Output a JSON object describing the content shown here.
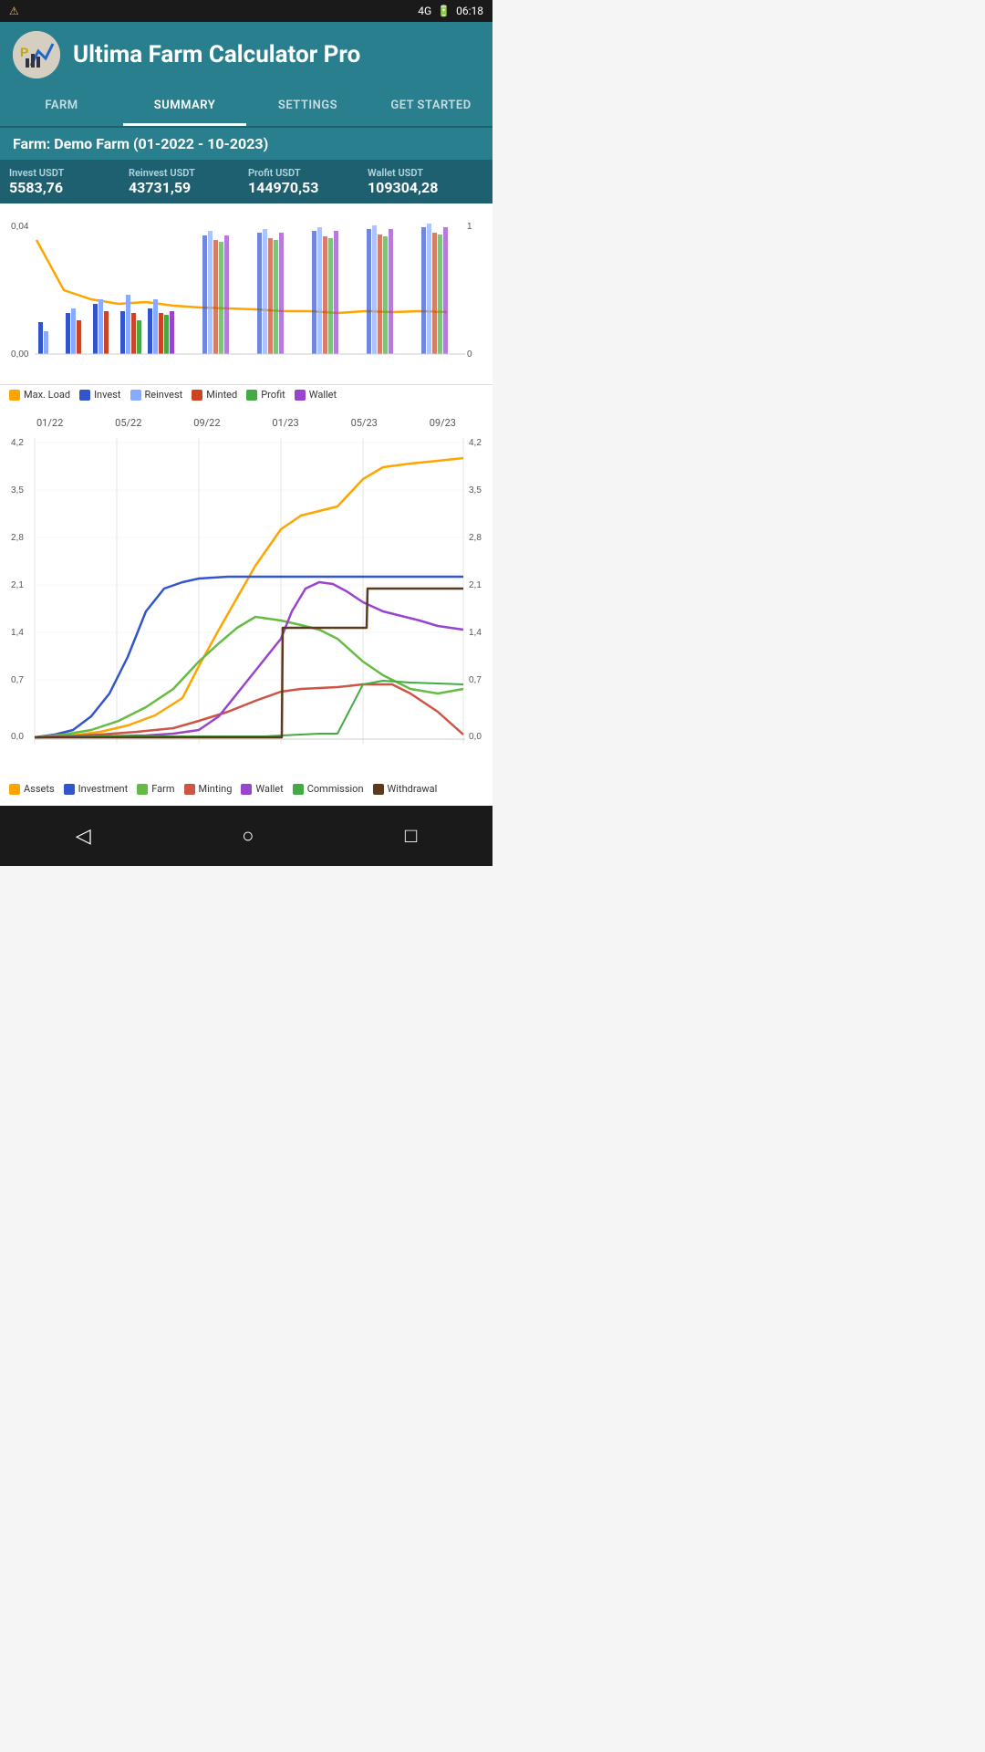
{
  "statusBar": {
    "network": "4G",
    "time": "06:18",
    "warning": "⚠"
  },
  "header": {
    "title": "Ultima Farm Calculator Pro",
    "logoIcon": "🅿"
  },
  "tabs": [
    {
      "id": "farm",
      "label": "FARM",
      "active": false
    },
    {
      "id": "summary",
      "label": "SUMMARY",
      "active": true
    },
    {
      "id": "settings",
      "label": "SETTINGS",
      "active": false
    },
    {
      "id": "get-started",
      "label": "GET STARTED",
      "active": false
    }
  ],
  "farmInfo": {
    "label": "Farm:  Demo Farm (01-2022 - 10-2023)"
  },
  "stats": [
    {
      "label": "Invest USDT",
      "value": "5583,76"
    },
    {
      "label": "Reinvest USDT",
      "value": "43731,59"
    },
    {
      "label": "Profit USDT",
      "value": "144970,53"
    },
    {
      "label": "Wallet USDT",
      "value": "109304,28"
    }
  ],
  "chart1": {
    "legend": [
      {
        "label": "Max. Load",
        "color": "#FFA500"
      },
      {
        "label": "Invest",
        "color": "#3355cc"
      },
      {
        "label": "Reinvest",
        "color": "#88aaff"
      },
      {
        "label": "Minted",
        "color": "#cc4422"
      },
      {
        "label": "Profit",
        "color": "#44aa44"
      },
      {
        "label": "Wallet",
        "color": "#9944cc"
      }
    ]
  },
  "chart2": {
    "xLabels": [
      "01/22",
      "05/22",
      "09/22",
      "01/23",
      "05/23",
      "09/23"
    ],
    "yLabels": [
      "0,0",
      "0,7",
      "1,4",
      "2,1",
      "2,8",
      "3,5",
      "4,2"
    ],
    "legend": [
      {
        "label": "Assets",
        "color": "#FFA500"
      },
      {
        "label": "Investment",
        "color": "#3355cc"
      },
      {
        "label": "Farm",
        "color": "#66bb44"
      },
      {
        "label": "Minting",
        "color": "#cc5544"
      },
      {
        "label": "Wallet",
        "color": "#9944cc"
      },
      {
        "label": "Commission",
        "color": "#44aa44"
      },
      {
        "label": "Withdrawal",
        "color": "#5c3a1e"
      }
    ]
  },
  "bottomNav": {
    "back": "◁",
    "home": "○",
    "recent": "□"
  }
}
